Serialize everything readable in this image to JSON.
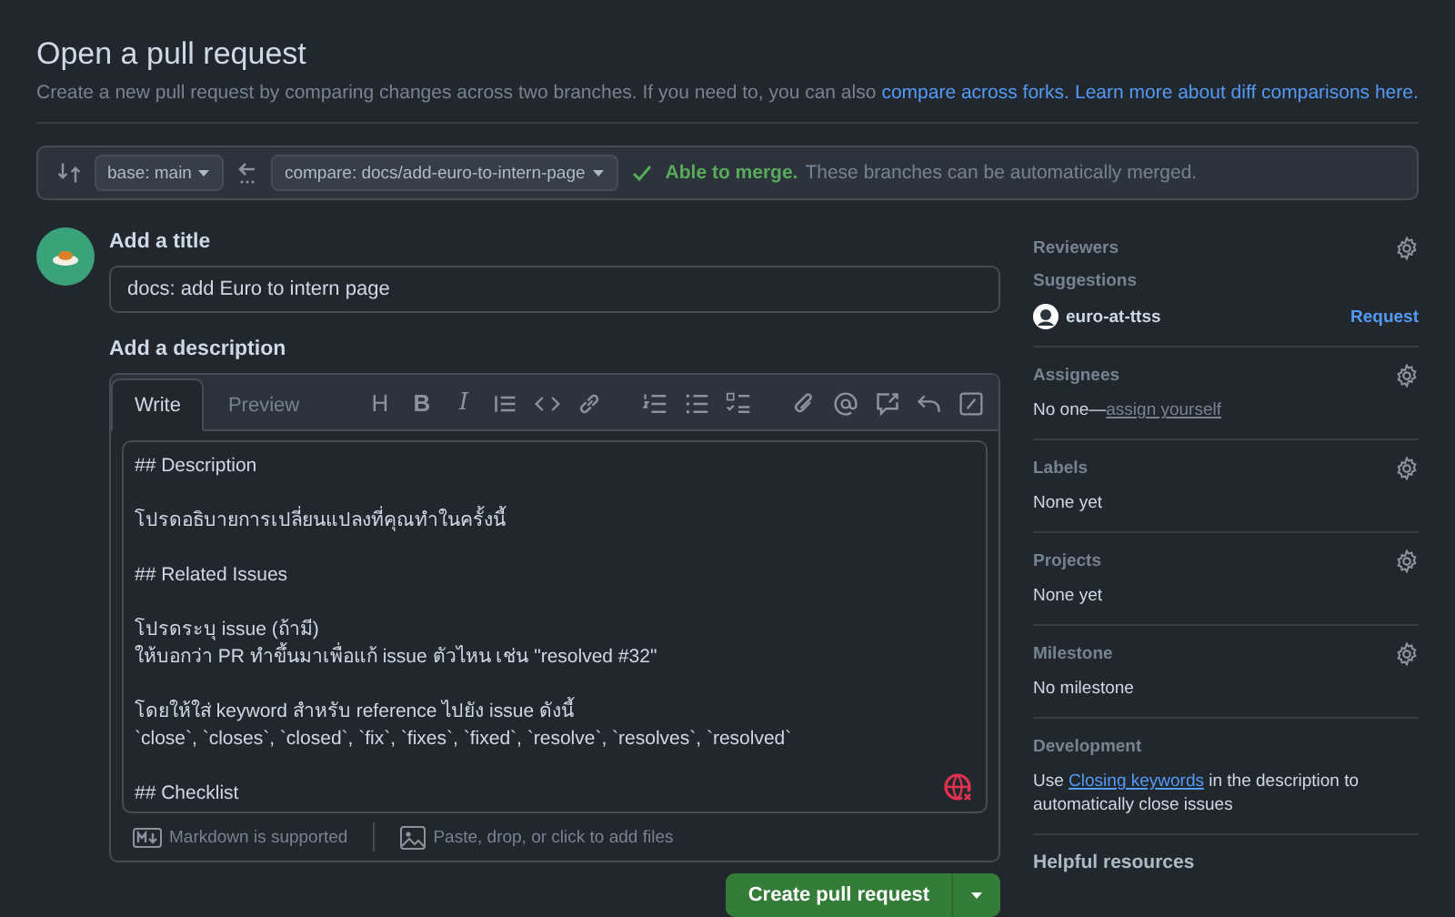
{
  "header": {
    "title": "Open a pull request",
    "subtitle": "Create a new pull request by comparing changes across two branches. If you need to, you can also",
    "links": [
      "compare across forks.",
      "Learn more about diff comparisons here."
    ]
  },
  "compare_bar": {
    "base": "base: main",
    "compare": "compare: docs/add-euro-to-intern-page",
    "status": "Able to merge.",
    "message": "These branches can be automatically merged."
  },
  "title_field": {
    "label": "Add a title",
    "value": "docs: add Euro to intern page"
  },
  "description": {
    "label": "Add a description",
    "tabs": [
      {
        "label": "Write",
        "selected": true
      },
      {
        "label": "Preview",
        "selected": false
      }
    ],
    "format_buttons": [
      "H",
      "B",
      "I"
    ],
    "value": "## Description\n\nโปรดอธิบายการเปลี่ยนแปลงที่คุณทำในครั้งนี้\n\n## Related Issues\n\nโปรดระบุ issue (ถ้ามี)\nให้บอกว่า PR ทำขึ้นมาเพื่อแก้ issue ตัวไหน เช่น \"resolved #32\"\n\nโดยให้ใส่ keyword สำหรับ reference ไปยัง issue ดังนี้\n`close`, `closes`, `closed`, `fix`, `fixes`, `fixed`, `resolve`, `resolves`, `resolved`\n\n## Checklist",
    "markdown_note": "Markdown is supported",
    "attach_note": "Paste, drop, or click to add files"
  },
  "submit_button": "Create pull request",
  "sidebar": [
    {
      "kind": "reviewers",
      "title": "Reviewers",
      "settings": true,
      "subtitle": "Suggestions",
      "user": "euro-at-ttss",
      "action": "Request"
    },
    {
      "kind": "assign",
      "title": "Assignees",
      "settings": true,
      "text": "No one—",
      "link": "assign yourself"
    },
    {
      "kind": "text",
      "title": "Labels",
      "settings": true,
      "text": "None yet"
    },
    {
      "kind": "text",
      "title": "Projects",
      "settings": true,
      "text": "None yet"
    },
    {
      "kind": "text",
      "title": "Milestone",
      "settings": true,
      "text": "No milestone"
    },
    {
      "kind": "sentence",
      "title": "Development",
      "settings": false,
      "before": "Use",
      "link": "Closing keywords",
      "after": "in the description to automatically close issues"
    },
    {
      "kind": "heading",
      "title": "Helpful resources",
      "settings": false
    }
  ]
}
